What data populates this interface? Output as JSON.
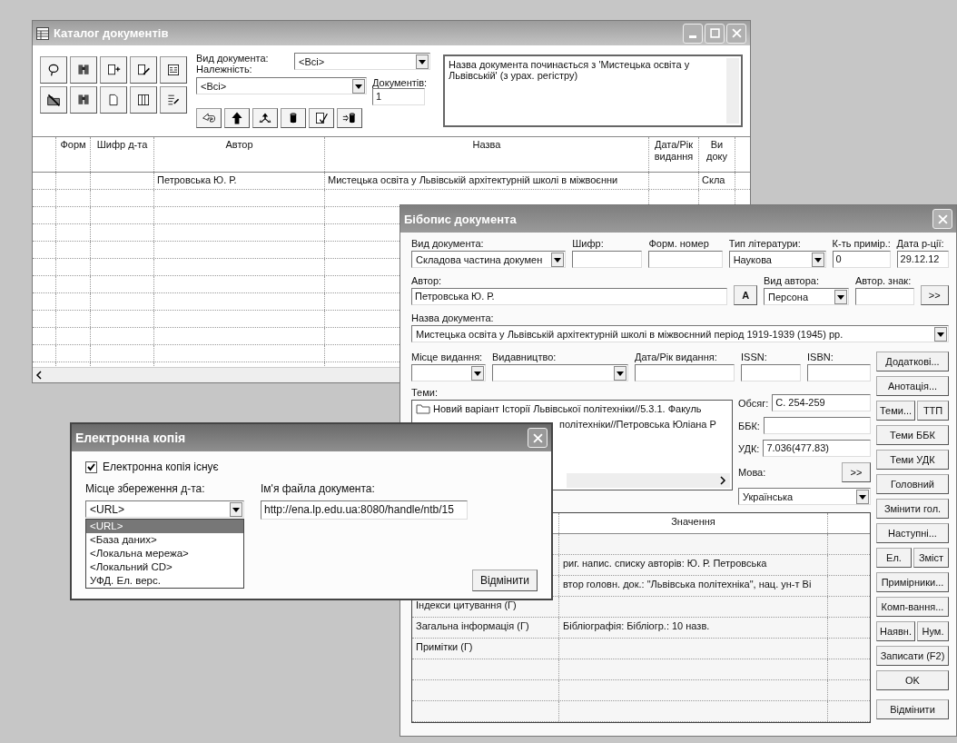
{
  "catalog_window": {
    "title": "Каталог документів",
    "doc_type_label": "Вид документа:",
    "doc_type_value": "<Всі>",
    "belonging_label": "Належність:",
    "belonging_value": "<Всі>",
    "count_label": "Документів:",
    "count_value": "1",
    "filter_text": "Назва документа починається з 'Мистецька освіта у Львівській' (з урах. регістру)",
    "columns": [
      {
        "label": "Форм"
      },
      {
        "label": "Шифр д-та"
      },
      {
        "label": "Автор"
      },
      {
        "label": "Назва"
      },
      {
        "label": "Дата/Рік видання"
      },
      {
        "label": "Ви доку"
      }
    ],
    "rows": [
      {
        "author": "Петровська Ю. Р.",
        "title": "Мистецька освіта у Львівській архітектурній школі в міжвоєнни",
        "column_6": "Скла"
      }
    ]
  },
  "description_window": {
    "title": "Бібопис документа",
    "doc_type": {
      "label": "Вид документа:",
      "value": "Складова частина докумен"
    },
    "code": {
      "label": "Шифр:"
    },
    "form_number": {
      "label": "Форм. номер"
    },
    "literature_type": {
      "label": "Тип літератури:",
      "value": "Наукова"
    },
    "copies": {
      "label": "К-ть примір.:",
      "value": "0"
    },
    "reg_date": {
      "label": "Дата р-ції:",
      "value": "29.12.12"
    },
    "author": {
      "label": "Автор:",
      "value": "Петровська Ю. Р."
    },
    "author_button": "A",
    "author_type": {
      "label": "Вид автора:",
      "value": "Персона"
    },
    "author_sign": {
      "label": "Автор. знак:"
    },
    "author_sign_button": ">>",
    "doc_title": {
      "label": "Назва документа:",
      "value": "Мистецька освіта у Львівській архітектурній школі в міжвоєнний період 1919-1939 (1945) рр."
    },
    "place": {
      "label": "Місце видання:"
    },
    "publisher": {
      "label": "Видавництво:"
    },
    "pub_date": {
      "label": "Дата/Рік видання:"
    },
    "issn": {
      "label": "ISSN:"
    },
    "isbn": {
      "label": "ISBN:"
    },
    "themes": {
      "label": "Теми:",
      "items": [
        {
          "text": "Новий варіант Історії Львівської політехніки//5.3.1. Факуль"
        },
        {
          "text": "політехніки//Петровська Юліана Р"
        }
      ]
    },
    "volume": {
      "label": "Обсяг:",
      "value": "С. 254-259"
    },
    "bbk": {
      "label": "ББК:"
    },
    "udc": {
      "label": "УДК:",
      "value": "7.036(477.83)"
    },
    "language": {
      "label": "Мова:",
      "button": ">>",
      "value": "Українська"
    },
    "table": {
      "header": "Значення",
      "rows": [
        {
          "value": "риг. напис. списку авторів: Ю. Р. Петровська"
        },
        {
          "value": "втор головн. док.: \"Львівська політехніка\", нац. ун-т Ві"
        },
        {
          "name": "Індекси цитування (Г)"
        },
        {
          "name": "Загальна інформація (Г)",
          "value": "Бібліографія: Бібліогр.: 10 назв."
        },
        {
          "name": "Примітки (Г)"
        }
      ]
    },
    "buttons": [
      [
        "Додаткові..."
      ],
      [
        "Анотація..."
      ],
      [
        "Теми...",
        "ТТП"
      ],
      [
        "Теми ББК"
      ],
      [
        "Теми УДК"
      ],
      [
        "Головний"
      ],
      [
        "Змінити гол."
      ],
      [
        "Наступні..."
      ],
      [
        "Ел.",
        "Зміст"
      ],
      [
        "Примірники..."
      ],
      [
        "Комп-вання..."
      ],
      [
        "Наявн.",
        "Нум."
      ],
      [
        "Записати (F2)"
      ],
      [
        "OK"
      ],
      [
        "Відмінити"
      ]
    ]
  },
  "e_copy_dialog": {
    "title": "Електронна копія",
    "exists": {
      "label": "Електронна копія існує",
      "checked": true
    },
    "storage": {
      "label": "Місце збереження д-та:",
      "value": "<URL>",
      "options": [
        {
          "text": "<URL>",
          "selected": true
        },
        {
          "text": "<База даних>",
          "selected": false
        },
        {
          "text": "<Локальна мережа>",
          "selected": false
        },
        {
          "text": "<Локальний CD>",
          "selected": false
        },
        {
          "text": "УФД. Ел. верс.",
          "selected": false
        }
      ]
    },
    "filename": {
      "label": "Ім'я файла документа:",
      "value": "http://ena.lp.edu.ua:8080/handle/ntb/15"
    },
    "cancel_button": "Відмінити"
  }
}
